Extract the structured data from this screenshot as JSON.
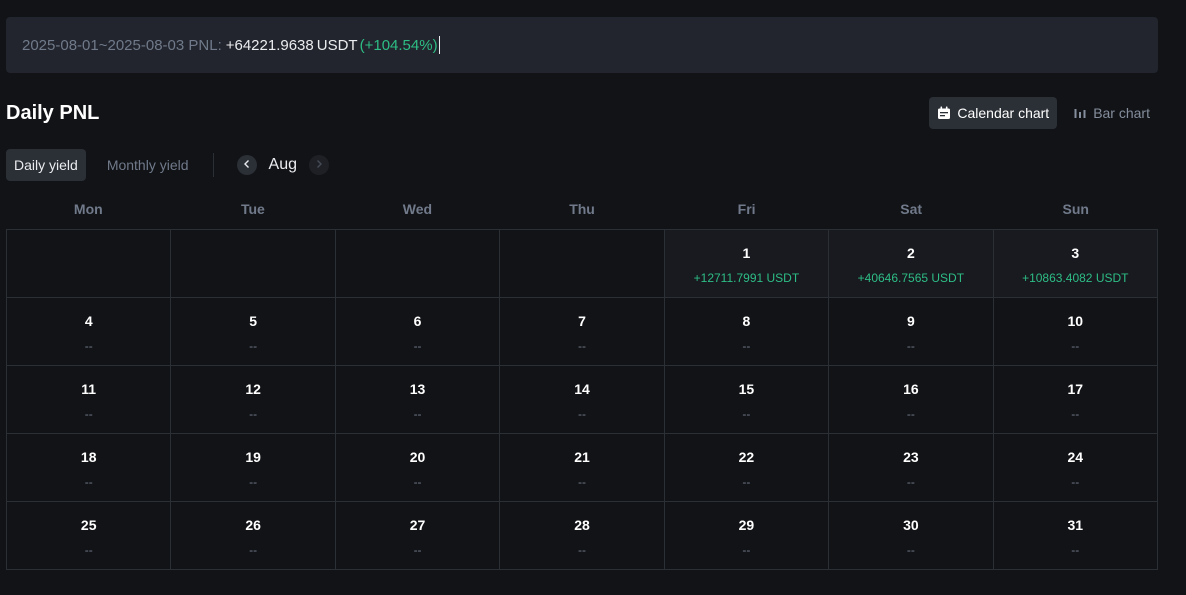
{
  "summary": {
    "range": "2025-08-01~2025-08-03 PNL:",
    "value": "+64221.9638",
    "unit": "USDT",
    "percent": "(+104.54%)"
  },
  "title": "Daily PNL",
  "chart_toggles": {
    "calendar": "Calendar chart",
    "bar": "Bar chart",
    "active": "calendar"
  },
  "yield_tabs": {
    "daily": "Daily yield",
    "monthly": "Monthly yield",
    "active": "daily"
  },
  "month": "Aug",
  "weekdays": [
    "Mon",
    "Tue",
    "Wed",
    "Thu",
    "Fri",
    "Sat",
    "Sun"
  ],
  "days": [
    {
      "day": "",
      "pnl": ""
    },
    {
      "day": "",
      "pnl": ""
    },
    {
      "day": "",
      "pnl": ""
    },
    {
      "day": "",
      "pnl": ""
    },
    {
      "day": "1",
      "pnl": "+12711.7991 USDT"
    },
    {
      "day": "2",
      "pnl": "+40646.7565 USDT"
    },
    {
      "day": "3",
      "pnl": "+10863.4082 USDT"
    },
    {
      "day": "4",
      "pnl": "--"
    },
    {
      "day": "5",
      "pnl": "--"
    },
    {
      "day": "6",
      "pnl": "--"
    },
    {
      "day": "7",
      "pnl": "--"
    },
    {
      "day": "8",
      "pnl": "--"
    },
    {
      "day": "9",
      "pnl": "--"
    },
    {
      "day": "10",
      "pnl": "--"
    },
    {
      "day": "11",
      "pnl": "--"
    },
    {
      "day": "12",
      "pnl": "--"
    },
    {
      "day": "13",
      "pnl": "--"
    },
    {
      "day": "14",
      "pnl": "--"
    },
    {
      "day": "15",
      "pnl": "--"
    },
    {
      "day": "16",
      "pnl": "--"
    },
    {
      "day": "17",
      "pnl": "--"
    },
    {
      "day": "18",
      "pnl": "--"
    },
    {
      "day": "19",
      "pnl": "--"
    },
    {
      "day": "20",
      "pnl": "--"
    },
    {
      "day": "21",
      "pnl": "--"
    },
    {
      "day": "22",
      "pnl": "--"
    },
    {
      "day": "23",
      "pnl": "--"
    },
    {
      "day": "24",
      "pnl": "--"
    },
    {
      "day": "25",
      "pnl": "--"
    },
    {
      "day": "26",
      "pnl": "--"
    },
    {
      "day": "27",
      "pnl": "--"
    },
    {
      "day": "28",
      "pnl": "--"
    },
    {
      "day": "29",
      "pnl": "--"
    },
    {
      "day": "30",
      "pnl": "--"
    },
    {
      "day": "31",
      "pnl": "--"
    }
  ],
  "colors": {
    "positive": "#2ebd85",
    "background": "#121317",
    "panel": "#22252d",
    "muted": "#707a8a"
  }
}
